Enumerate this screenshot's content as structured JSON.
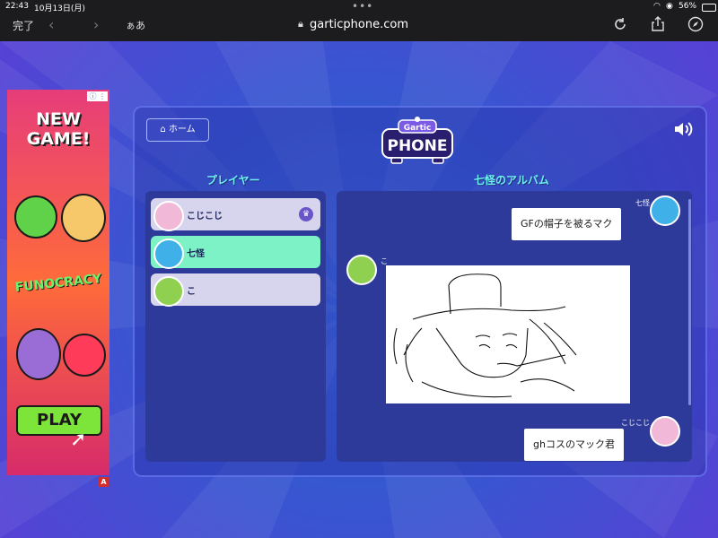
{
  "status": {
    "time": "22:43",
    "date": "10月13日(月)",
    "battery": "56%"
  },
  "browser": {
    "done": "完了",
    "aa": "ぁあ",
    "url": "garticphone.com"
  },
  "ad": {
    "headline": "NEW\nGAME!",
    "brand": "FUNOCRACY",
    "cta": "PLAY",
    "info": "ⓘ ⋮",
    "badge": "A"
  },
  "game": {
    "home_label": "ホーム",
    "logo_top": "Gartic",
    "logo_bottom": "PHONE",
    "players_title": "プレイヤー",
    "album_title": "七怪のアルバム",
    "players": [
      {
        "name": "こじこじ",
        "active": false,
        "host": true,
        "color": "#f2b8d8"
      },
      {
        "name": "七怪",
        "active": true,
        "host": false,
        "color": "#3fb0e8"
      },
      {
        "name": "こ",
        "active": false,
        "host": false,
        "color": "#8fd050"
      }
    ],
    "album": [
      {
        "author": "七怪",
        "text": "GFの帽子を被るマク"
      },
      {
        "author": "こ",
        "type": "drawing"
      },
      {
        "author": "こじこじ",
        "text": "ghコスのマック君"
      }
    ]
  }
}
